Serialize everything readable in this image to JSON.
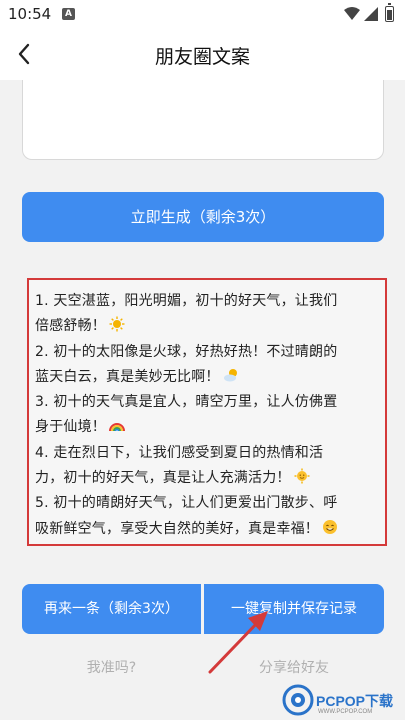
{
  "status_bar": {
    "time": "10:54",
    "notification_glyph": "A"
  },
  "header": {
    "title": "朋友圈文案",
    "back_icon": "back-arrow-icon"
  },
  "generate_button": {
    "label": "立即生成（剩余3次）"
  },
  "results": {
    "lines": [
      "1. 天空湛蓝，阳光明媚，初十的好天气，让我们",
      "倍感舒畅！",
      "2. 初十的太阳像是火球，好热好热！不过晴朗的",
      "蓝天白云，真是美妙无比啊！",
      "3. 初十的天气真是宜人，晴空万里，让人仿佛置",
      "身于仙境！",
      "4. 走在烈日下，让我们感受到夏日的热情和活",
      "力，初十的好天气，真是让人充满活力！",
      "5. 初十的晴朗好天气，让人们更爱出门散步、呼",
      "吸新鲜空气，享受大自然的美好，真是幸福！"
    ]
  },
  "actions": {
    "again_label": "再来一条（剩余3次）",
    "copy_save_label": "一键复制并保存记录",
    "accurate_label": "我准吗?",
    "share_label": "分享给好友"
  },
  "watermark": {
    "brand": "PCPOP下载",
    "url": "WWW.PCPOP.COM"
  },
  "colors": {
    "primary": "#3f8cf0",
    "highlight_border": "#d43a3a",
    "arrow": "#d43a3a"
  }
}
